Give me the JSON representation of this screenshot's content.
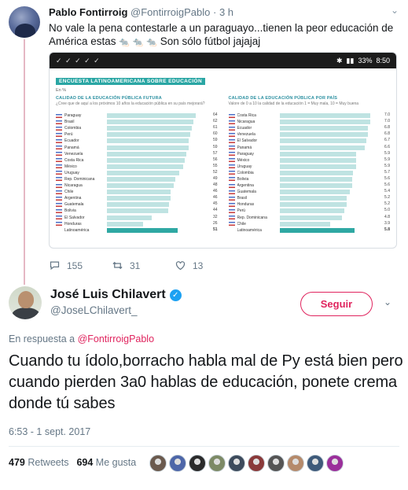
{
  "parent_tweet": {
    "name": "Pablo Fontirroig",
    "handle": "@FontirroigPablo",
    "time": "· 3 h",
    "text_line1": "No vale la pena contestarle a un paraguayo...tienen la peor educación de",
    "text_line2_a": "América estas",
    "text_line2_b": "Son sólo fútbol jajajaj",
    "emojis": [
      "🐀",
      "🐀",
      "🐀"
    ],
    "replies": "155",
    "retweets": "31",
    "likes": "13"
  },
  "embedded_screenshot": {
    "status_time": "8:50",
    "status_battery": "33%",
    "title": "ENCUESTA LATINOAMERICANA SOBRE EDUCACIÓN",
    "unit": "En %",
    "left_title": "CALIDAD DE LA EDUCACIÓN PÚBLICA FUTURA",
    "left_sub": "¿Cree que de aquí a los próximos 10 años la educación pública en su país mejorará?",
    "right_title": "CALIDAD DE LA EDUCACIÓN PÚBLICA POR PAÍS",
    "right_sub": "Valore de 0 a 10 la calidad de la educación 1 = Muy mala, 10 = Muy buena"
  },
  "chart_data": [
    {
      "type": "bar",
      "title": "CALIDAD DE LA EDUCACIÓN PÚBLICA FUTURA",
      "categories": [
        "Paraguay",
        "Brasil",
        "Colombia",
        "Perú",
        "Ecuador",
        "Panamá",
        "Venezuela",
        "Costa Rica",
        "México",
        "Uruguay",
        "Rep. Dominicana",
        "Nicaragua",
        "Chile",
        "Argentina",
        "Guatemala",
        "Bolivia",
        "El Salvador",
        "Honduras",
        "Latinoamérica"
      ],
      "values": [
        64,
        62,
        61,
        60,
        59,
        59,
        57,
        56,
        55,
        52,
        49,
        48,
        46,
        46,
        45,
        44,
        32,
        26,
        51
      ],
      "ylim": [
        0,
        70
      ]
    },
    {
      "type": "bar",
      "title": "CALIDAD DE LA EDUCACIÓN PÚBLICA POR PAÍS",
      "categories": [
        "Costa Rica",
        "Nicaragua",
        "Ecuador",
        "Venezuela",
        "El Salvador",
        "Panamá",
        "Paraguay",
        "México",
        "Uruguay",
        "Colombia",
        "Bolivia",
        "Argentina",
        "Guatemala",
        "Brasil",
        "Honduras",
        "Perú",
        "Rep. Dominicana",
        "Chile",
        "Latinoamérica"
      ],
      "values": [
        7.0,
        7.0,
        6.8,
        6.8,
        6.7,
        6.6,
        5.9,
        5.9,
        5.9,
        5.7,
        5.6,
        5.6,
        5.4,
        5.2,
        5.2,
        5.0,
        4.8,
        3.9,
        5.8
      ],
      "ylim": [
        0,
        7.5
      ]
    }
  ],
  "main_tweet": {
    "name": "José Luis Chilavert",
    "handle": "@JoseLChilavert_",
    "follow_label": "Seguir",
    "reply_prefix": "En respuesta a",
    "reply_handle": "@FontirroigPablo",
    "text": "Cuando tu ídolo,borracho habla mal de Py está bien pero cuando pierden 3a0 hablas de educación, ponete crema donde tú sabes",
    "timestamp": "6:53 - 1 sept. 2017",
    "retweets_count": "479",
    "retweets_label": "Retweets",
    "likes_count": "694",
    "likes_label": "Me gusta"
  },
  "colors": {
    "accent": "#e0245e",
    "verified": "#1da1f2",
    "bar": "#bfe3e2",
    "bar_total": "#2fa8a3"
  },
  "liker_colors": [
    "#6b5a4e",
    "#4d66a8",
    "#2b2b2b",
    "#7d8a66",
    "#3d4b5c",
    "#8a3a3a",
    "#555",
    "#b58a6b",
    "#3e5a7a",
    "#9b2f9b"
  ]
}
